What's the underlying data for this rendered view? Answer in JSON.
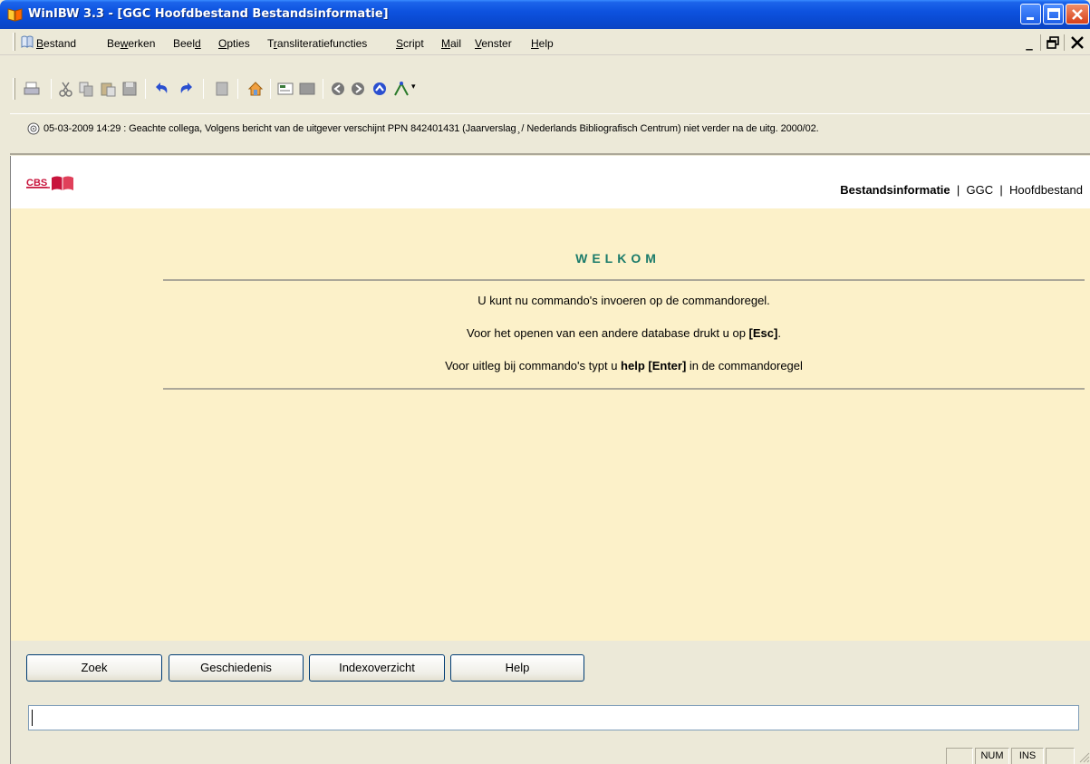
{
  "window": {
    "title": "WinIBW 3.3 - [GGC Hoofdbestand Bestandsinformatie]"
  },
  "menu": {
    "items": [
      {
        "pre": "",
        "key": "B",
        "post": "estand"
      },
      {
        "pre": "Be",
        "key": "w",
        "post": "erken"
      },
      {
        "pre": "Beel",
        "key": "d",
        "post": ""
      },
      {
        "pre": "",
        "key": "O",
        "post": "pties"
      },
      {
        "pre": "T",
        "key": "r",
        "post": "ansliteratiefuncties"
      },
      {
        "pre": "",
        "key": "S",
        "post": "cript"
      },
      {
        "pre": "",
        "key": "M",
        "post": "ail"
      },
      {
        "pre": "",
        "key": "V",
        "post": "enster"
      },
      {
        "pre": "",
        "key": "H",
        "post": "elp"
      }
    ],
    "mdi_minimize": "_",
    "mdi_restore": "🗗",
    "mdi_close": "✕"
  },
  "toolbar": {
    "icons": [
      "print-icon",
      "cut-icon",
      "copy-icon",
      "paste-icon",
      "save-icon",
      "undo-icon",
      "redo-icon",
      "document-icon",
      "home-icon",
      "card-icon",
      "panel-icon",
      "back-icon",
      "forward-icon",
      "up-icon",
      "script-icon"
    ]
  },
  "message": {
    "text": "05-03-2009 14:29 : Geachte collega, Volgens bericht van de uitgever verschijnt PPN 842401431 (Jaarverslag ̧ / Nederlands Bibliografisch Centrum) niet verder na de uitg. 2000/02."
  },
  "header": {
    "logo_text": "CBS",
    "crumb_1": "Bestandsinformatie",
    "sep": "|",
    "crumb_2": "GGC",
    "crumb_3": "Hoofdbestand"
  },
  "welcome": {
    "title": "WELKOM",
    "line1": "U kunt nu commando's invoeren op de commandoregel.",
    "line2_pre": "Voor het openen van een andere database drukt u op ",
    "line2_key": "[Esc]",
    "line2_post": ".",
    "line3_pre": "Voor uitleg bij commando's typt u ",
    "line3_key": "help [Enter]",
    "line3_post": " in de commandoregel"
  },
  "buttons": {
    "zoek": "Zoek",
    "geschiedenis": "Geschiedenis",
    "indexoverzicht": "Indexoverzicht",
    "help": "Help"
  },
  "command": {
    "value": "",
    "placeholder": ""
  },
  "status": {
    "num": "NUM",
    "ins": "INS"
  },
  "colors": {
    "titlebar": "#0a4ad2",
    "pane": "#fcf1c9",
    "welcome": "#1b7b6a",
    "logo": "#c8143c"
  }
}
